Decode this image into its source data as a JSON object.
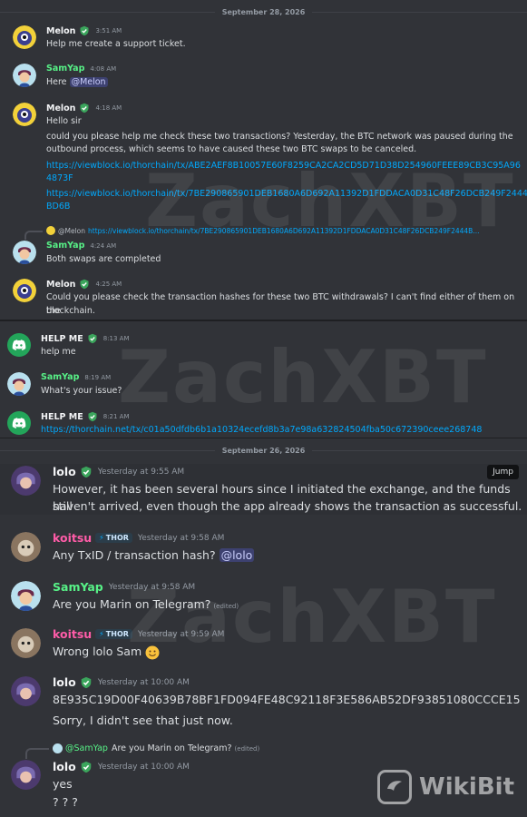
{
  "dates": {
    "top": "September 28, 2026",
    "mid": "September 26, 2026"
  },
  "messages_a": [
    {
      "user": "Melon",
      "time": "3:51 AM",
      "lines": [
        "Help me create a support ticket."
      ]
    },
    {
      "user": "SamYap",
      "time": "4:08 AM",
      "text": "Here",
      "mention": "@Melon"
    },
    {
      "user": "Melon",
      "time": "4:18 AM",
      "lines": [
        "Hello sir",
        "could you please help me check these two transactions? Yesterday, the BTC network was paused during the",
        "outbound process, which seems to have caused these two BTC swaps to be canceled."
      ],
      "links": [
        "https://viewblock.io/thorchain/tx/ABE2AEF8B10057E60F8259CA2CA2CD5D71D38D254960FEEE89CB3C95A96",
        "4873F",
        "https://viewblock.io/thorchain/tx/7BE290865901DEB1680A6D692A11392D1FDDACA0D31C48F26DCB249F2444",
        "BD6B"
      ]
    },
    {
      "reply_user": "@Melon",
      "reply_text": "https://viewblock.io/thorchain/tx/7BE290865901DEB1680A6D692A11392D1FDDACA0D31C48F26DCB249F2444B...",
      "user": "SamYap",
      "time": "4:24 AM",
      "lines": [
        "Both swaps are completed"
      ]
    },
    {
      "user": "Melon",
      "time": "4:25 AM",
      "lines": [
        "Could you please check the transaction hashes for these two BTC withdrawals? I can't find either of them on the",
        "blockchain."
      ]
    }
  ],
  "messages_b": [
    {
      "user": "HELP ME",
      "time": "8:13 AM",
      "lines": [
        "help me"
      ]
    },
    {
      "user": "SamYap",
      "time": "8:19 AM",
      "lines": [
        "What's your issue?"
      ]
    },
    {
      "user": "HELP ME",
      "time": "8:21 AM",
      "link": "https://thorchain.net/tx/c01a50dfdb6b1a10324ecefd8b3a7e98a632824504fba50c672390ceee268748"
    }
  ],
  "messages_c": [
    {
      "user": "lolo",
      "time": "Yesterday at 9:55 AM",
      "lines": [
        "However, it has been several hours since I initiated the exchange, and the funds still",
        "haven't arrived, even though the app already shows the transaction as successful."
      ]
    },
    {
      "user": "koitsu",
      "tag": "THOR",
      "time": "Yesterday at 9:58 AM",
      "text": "Any TxID / transaction hash?",
      "mention": "@lolo"
    },
    {
      "user": "SamYap",
      "time": "Yesterday at 9:58 AM",
      "text": "Are you Marin on Telegram?",
      "edited": "(edited)"
    },
    {
      "user": "koitsu",
      "tag": "THOR",
      "time": "Yesterday at 9:59 AM",
      "text": "Wrong lolo Sam"
    },
    {
      "user": "lolo",
      "time": "Yesterday at 10:00 AM",
      "lines": [
        "8E935C19D00F40639B78BF1FD094FE48C92118F3E586AB52DF93851080CCCE15",
        "Sorry, I didn't see that just now."
      ]
    },
    {
      "reply_user": "@SamYap",
      "reply_text": "Are you Marin on Telegram?",
      "reply_edited": "(edited)",
      "user": "lolo",
      "time": "Yesterday at 10:00 AM",
      "lines": [
        "yes",
        "? ? ?"
      ]
    }
  ],
  "jump_label": "Jump",
  "watermark": "ZachXBT",
  "wikibit": "WikiBit",
  "icons": {
    "badge": "shield-check-icon",
    "discord": "discord-logo-icon",
    "bolt": "lightning-icon",
    "smile": "smile-emoji-icon"
  },
  "colors": {
    "bg": "#313338",
    "link": "#00a8fc",
    "mention_bg": "#3c4270",
    "green_name": "#57f287",
    "pink_name": "#ff5ca8"
  }
}
